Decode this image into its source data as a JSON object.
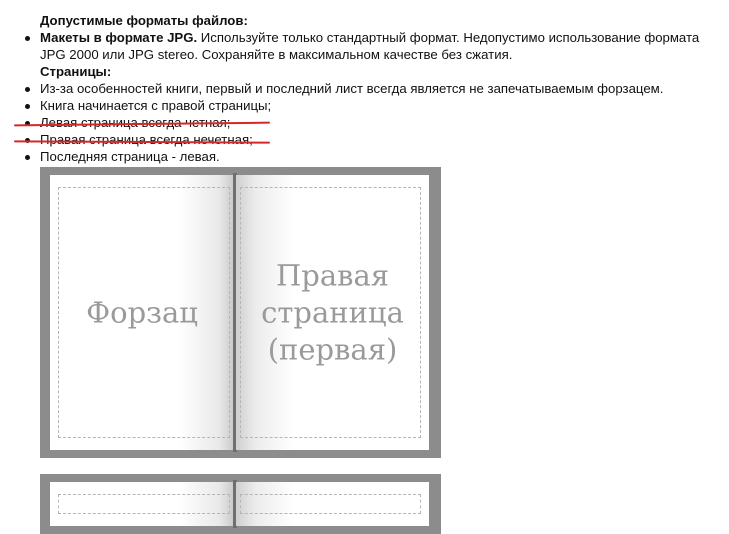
{
  "formats": {
    "heading": "Допустимые форматы файлов:",
    "items": [
      {
        "bold": "Макеты в формате JPG.",
        "text": " Используйте только стандартный формат. Недопустимо использование формата JPG 2000 или JPG stereo. Сохраняйте в максимальном качестве без сжатия."
      }
    ]
  },
  "pages": {
    "heading": "Страницы:",
    "items": [
      "Из-за особенностей книги, первый и последний лист всегда является не запечатываемым форзацем.",
      "Книга начинается с правой страницы;",
      "Левая страница всегда четная;",
      "Правая страница всегда нечетная;",
      "Последняя страница - левая."
    ]
  },
  "illustration": {
    "left_page_label": "Форзац",
    "right_page_label_lines": [
      "Правая",
      "страница",
      "(первая)"
    ]
  },
  "colors": {
    "underline": "#d62828",
    "book_border": "#8c8c8c",
    "page_label": "#9a9a9a"
  }
}
